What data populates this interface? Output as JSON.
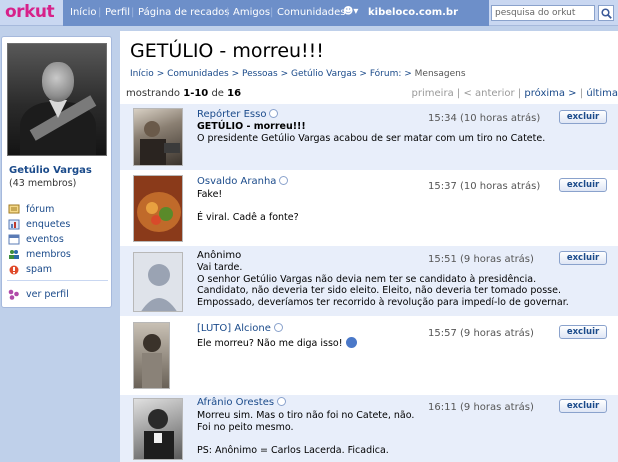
{
  "app": {
    "logo": "orkut"
  },
  "nav": {
    "items": [
      "Início",
      "Perfil",
      "Página de recados",
      "Amigos",
      "Comunidades"
    ],
    "site": "kibeloco.com.br",
    "search_placeholder": "pesquisa do orkut"
  },
  "sidebar": {
    "group_name": "Getúlio Vargas",
    "members": "(43 membros)",
    "menu": [
      {
        "label": "fórum",
        "icon": "forum-icon"
      },
      {
        "label": "enquetes",
        "icon": "poll-icon"
      },
      {
        "label": "eventos",
        "icon": "calendar-icon"
      },
      {
        "label": "membros",
        "icon": "members-icon"
      },
      {
        "label": "spam",
        "icon": "spam-icon"
      }
    ],
    "view_profile": "ver perfil"
  },
  "page": {
    "title": "GETÚLIO - morreu!!!",
    "breadcrumb": [
      "Início",
      "Comunidades",
      "Pessoas",
      "Getúlio Vargas",
      "Fórum:",
      "Mensagens"
    ],
    "showing_prefix": "mostrando",
    "showing_range": "1-10",
    "showing_of": "de",
    "showing_total": "16",
    "pager": {
      "first": "primeira",
      "prev": "< anterior",
      "next": "próxima >",
      "last": "última"
    }
  },
  "posts": [
    {
      "author": "Repórter Esso",
      "time": "15:34 (10 horas atrás)",
      "delete": "excluir",
      "subject": "GETÚLIO - morreu!!!",
      "text": "O presidente Getúlio Vargas acabou de ser matar com um tiro no Catete."
    },
    {
      "author": "Osvaldo Aranha",
      "time": "15:37 (10 horas atrás)",
      "delete": "excluir",
      "text": "Fake!\n\nÉ viral. Cadê a fonte?"
    },
    {
      "author": "Anônimo",
      "time": "15:51 (9 horas atrás)",
      "delete": "excluir",
      "text": "Vai tarde.\nO senhor Getúlio Vargas não devia nem ter se candidato à presidência.\nCandidato, não deveria ter sido eleito. Eleito, não deveria ter tomado posse.\nEmpossado, deveríamos ter recorrido à revolução para impedí-lo de governar."
    },
    {
      "author": "[LUTO] Alcione",
      "time": "15:57 (9 horas atrás)",
      "delete": "excluir",
      "text": "Ele morreu? Não me diga isso!"
    },
    {
      "author": "Afrânio Orestes",
      "time": "16:11 (9 horas atrás)",
      "delete": "excluir",
      "text": "Morreu sim. Mas o tiro não foi no Catete, não.\nFoi no peito mesmo.\n\nPS: Anônimo = Carlos Lacerda. Ficadica."
    }
  ]
}
